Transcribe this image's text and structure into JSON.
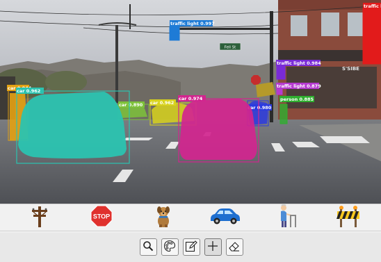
{
  "colors": {
    "sky": "#c9ccd1",
    "road": "#5c5e63",
    "car_teal": "#2bc3b0",
    "car_magenta": "#d2258f",
    "car_yellow": "#d8d21c",
    "traffic_light_blue": "#1e7bd6",
    "traffic_light_purple": "#7a2ad8",
    "traffic_light_red": "#e21b1b",
    "person_green": "#2fae2f",
    "category_bar_bg": "#f1f1f1",
    "toolbar_bg": "#e8e8e8"
  },
  "detections": [
    {
      "label": "car 0.944",
      "class": "car"
    },
    {
      "label": "car 0.962",
      "class": "car"
    },
    {
      "label": "car 0.890",
      "class": "car"
    },
    {
      "label": "car 0.962",
      "class": "car"
    },
    {
      "label": "car 0.974",
      "class": "car"
    },
    {
      "label": "car 0.980",
      "class": "car"
    },
    {
      "label": "person 0.885",
      "class": "person"
    },
    {
      "label": "traffic light 0.997",
      "class": "traffic-light"
    },
    {
      "label": "traffic light 0.984",
      "class": "traffic-light"
    },
    {
      "label": "traffic light 0.879",
      "class": "traffic-light"
    },
    {
      "label": "traffic l",
      "class": "traffic-light"
    }
  ],
  "scene_text": {
    "street_sign": "Fell St",
    "stop_sign": "STOP",
    "storefront": "S'SIBE"
  },
  "category_bar": {
    "items": [
      {
        "icon": "utility-pole-icon",
        "name": "utility pole"
      },
      {
        "icon": "stop-sign-icon",
        "name": "stop sign",
        "text": "STOP"
      },
      {
        "icon": "dog-icon",
        "name": "dog"
      },
      {
        "icon": "car-icon",
        "name": "car"
      },
      {
        "icon": "elderly-person-icon",
        "name": "person with walker"
      },
      {
        "icon": "road-barrier-icon",
        "name": "road barrier"
      }
    ]
  },
  "toolbar": {
    "tools": [
      {
        "icon": "magnifier-icon",
        "name": "zoom"
      },
      {
        "icon": "palette-icon",
        "name": "color"
      },
      {
        "icon": "pencil-icon",
        "name": "edit"
      },
      {
        "icon": "plus-icon",
        "name": "add",
        "selected": true
      },
      {
        "icon": "eraser-icon",
        "name": "erase"
      }
    ]
  }
}
